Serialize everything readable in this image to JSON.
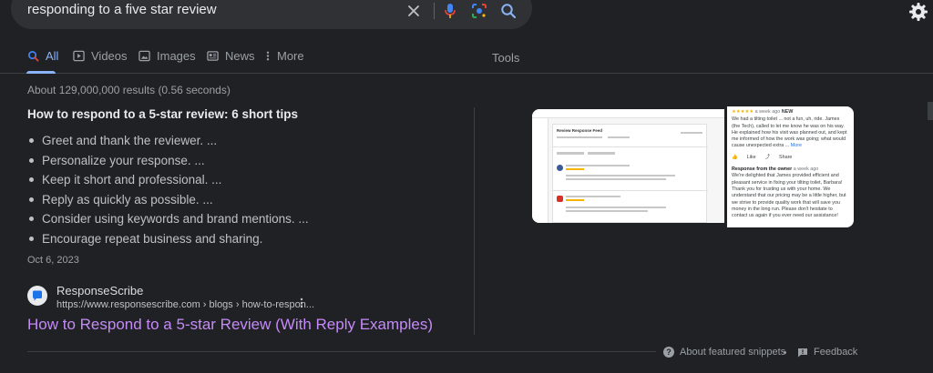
{
  "search": {
    "query": "responding to a five star review"
  },
  "tabs": [
    {
      "label": "All",
      "active": true,
      "icon": "search-icon"
    },
    {
      "label": "Videos",
      "active": false,
      "icon": "play-icon"
    },
    {
      "label": "Images",
      "active": false,
      "icon": "image-icon"
    },
    {
      "label": "News",
      "active": false,
      "icon": "news-icon"
    },
    {
      "label": "More",
      "active": false,
      "icon": "more-vertical-icon"
    }
  ],
  "tools_label": "Tools",
  "result_stats": "About 129,000,000 results (0.56 seconds)",
  "snippet": {
    "title": "How to respond to a 5-star review: 6 short tips",
    "items": [
      "Greet and thank the reviewer. ...",
      "Personalize your response. ...",
      "Keep it short and professional. ...",
      "Reply as quickly as possible. ...",
      "Consider using keywords and brand mentions. ...",
      "Encourage repeat business and sharing."
    ],
    "date": "Oct 6, 2023"
  },
  "source": {
    "site_name": "ResponseScribe",
    "url": "https://www.responsescribe.com › blogs › how-to-respon...",
    "title": "How to Respond to a 5-star Review (With Reply Examples)"
  },
  "image_left": {
    "header": "Review Response Feed"
  },
  "image_right": {
    "stars": "★★★★★",
    "age": "a week ago",
    "badge": "NEW",
    "review": "We had a tilting toilet ... not a fun, uh, ride. James (the Tech), called to let me know he was on his way. He explained how his visit was planned out, and kept me informed of how the work was going; what would cause unexpected extra ...",
    "more": "More",
    "like": "Like",
    "share": "Share",
    "owner_heading": "Response from the owner",
    "owner_age": "a week ago",
    "owner_response": "We're delighted that James provided efficient and pleasant service in fixing your tilting toilet, Barbara! Thank you for trusting us with your home. We understand that our pricing may be a little higher, but we strive to provide quality work that will save you money in the long run. Please don't hesitate to contact us again if you ever need our assistance!"
  },
  "footer": {
    "about_label": "About featured snippets",
    "feedback_label": "Feedback"
  },
  "colors": {
    "background": "#202124",
    "link_visited": "#c58af9",
    "accent": "#8ab4f8",
    "text": "#bdc1c6"
  }
}
